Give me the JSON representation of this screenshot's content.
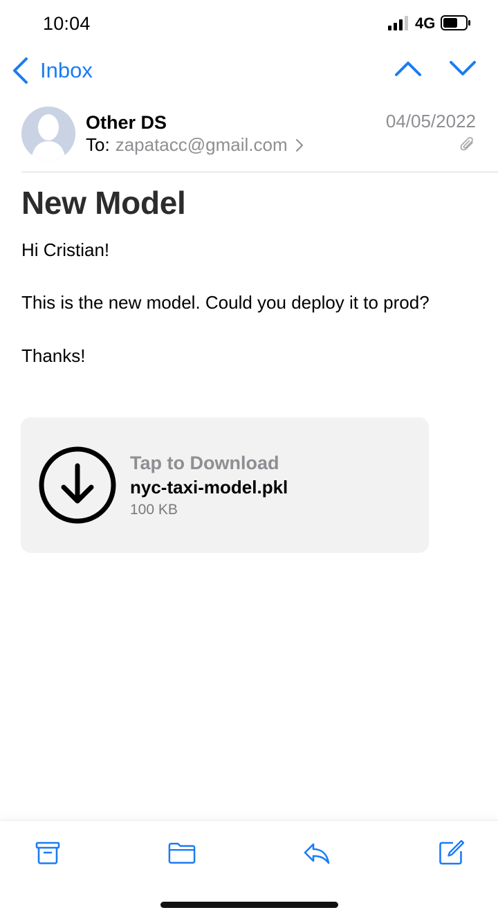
{
  "status_bar": {
    "time": "10:04",
    "network": "4G",
    "icons": [
      "signal-icon",
      "battery-icon"
    ]
  },
  "nav": {
    "back_label": "Inbox",
    "icons": [
      "back-chevron-icon",
      "previous-message-icon",
      "next-message-icon"
    ]
  },
  "header": {
    "sender_name": "Other DS",
    "recipient_prefix": "To:",
    "recipient_address": "zapatacc@gmail.com",
    "date": "04/05/2022",
    "icons": [
      "avatar-placeholder-icon",
      "chevron-right-icon",
      "paperclip-icon"
    ]
  },
  "message": {
    "subject": "New Model",
    "lines": [
      "Hi Cristian!",
      "This is the new model. Could you deploy it to prod?",
      "Thanks!"
    ]
  },
  "attachment": {
    "action": "Tap to Download",
    "filename": "nyc-taxi-model.pkl",
    "size": "100 KB",
    "icon": "download-icon"
  },
  "toolbar": {
    "icons": [
      "archive-icon",
      "folder-icon",
      "reply-icon",
      "compose-icon"
    ]
  },
  "colors": {
    "accent": "#1a7cf5",
    "secondary_text": "#8e8e93",
    "attachment_bg": "#f2f2f2"
  }
}
